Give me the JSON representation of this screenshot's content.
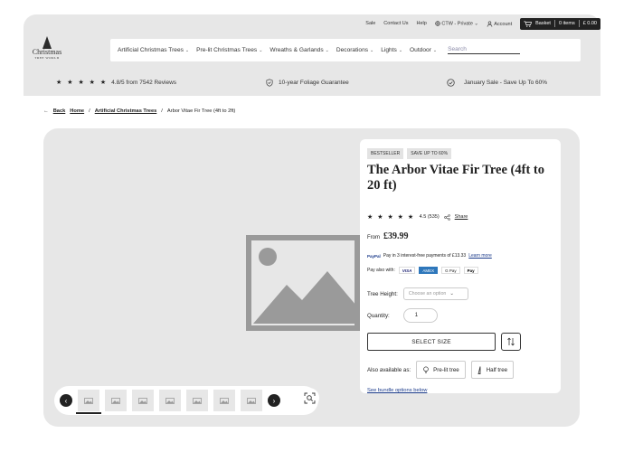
{
  "topbar": {
    "links": [
      "Sale",
      "Contact Us",
      "Help",
      "CTW - Private",
      "Account"
    ],
    "basket_label": "Basket",
    "basket_items": "0 items",
    "basket_total": "£ 0.00"
  },
  "logo": {
    "name": "Christmas",
    "sub": "TREE WORLD"
  },
  "nav": {
    "items": [
      "Artificial Christmas Trees",
      "Pre-lit Christmas Trees",
      "Wreaths & Garlands",
      "Decorations",
      "Lights",
      "Outdoor"
    ],
    "search_placeholder": "Search"
  },
  "trust": {
    "stars": "★ ★ ★ ★ ★",
    "reviews": "4.8/5 from 7542 Reviews",
    "guarantee": "10-year Foliage Guarantee",
    "sale": "January Sale - Save Up To 60%"
  },
  "breadcrumb": {
    "back": "Back",
    "home": "Home",
    "category": "Artificial Christmas Trees",
    "current": "Arbor Vitae Fir Tree (4ft to 2ft)"
  },
  "product": {
    "badges": [
      "BESTSELLER",
      "SAVE UP TO 60%"
    ],
    "title": "The Arbor Vitae Fir Tree (4ft to 20 ft)",
    "stars": "★ ★ ★ ★ ★",
    "rating_text": "4.5 (535)",
    "rating_value": 4.5,
    "share": "Share",
    "price_from": "From",
    "price": "£39.99",
    "paypal_brand": "PayPal",
    "paypal_text": "Pay in 3 interest-free payments of £13.33",
    "paypal_learn": "Learn more",
    "pay_also": "Pay also with:",
    "pay_methods": [
      "VISA",
      "AMEX",
      "G Pay",
      "Pay"
    ],
    "height_label": "Tree Height:",
    "height_placeholder": "Choose an option",
    "qty_label": "Quantity:",
    "qty_value": "1",
    "select_size": "SELECT SIZE",
    "avail_label": "Also available as:",
    "prelit_label": "Pre-lit tree",
    "half_label": "Half tree",
    "bundle": "See bundle options below"
  },
  "gallery": {
    "thumb_count": 7
  },
  "colors": {
    "panel_bg": "#e7e7e7",
    "dark": "#222222",
    "link": "#1a3a8a"
  }
}
